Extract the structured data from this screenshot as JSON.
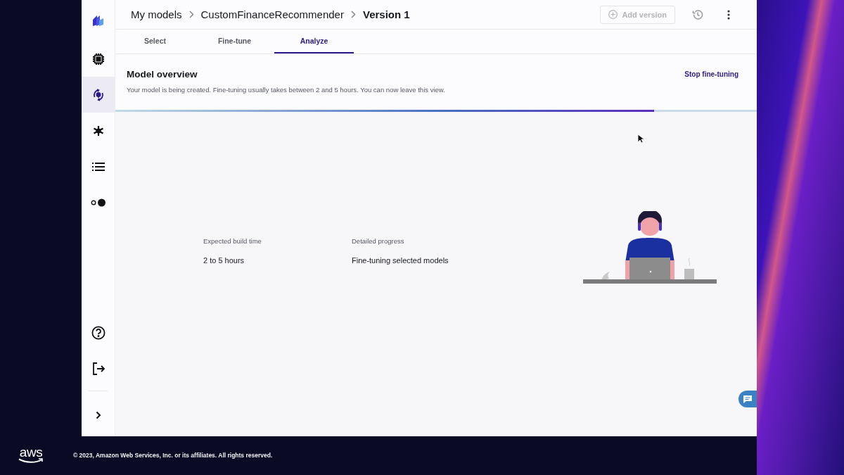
{
  "sidebar": {
    "items": [
      {
        "selected": false
      },
      {
        "selected": true
      },
      {
        "selected": false
      },
      {
        "selected": false
      },
      {
        "selected": false
      }
    ],
    "bottom_items": [
      {
        "selected": false
      },
      {
        "selected": false
      }
    ]
  },
  "breadcrumbs": [
    "My models",
    "CustomFinanceRecommender",
    "Version 1"
  ],
  "header_actions": {
    "add_version": {
      "label": "Add version",
      "disabled": true
    }
  },
  "tabs": [
    {
      "label": "Select",
      "selected": false
    },
    {
      "label": "Fine-tune",
      "selected": false
    },
    {
      "label": "Analyze",
      "selected": true
    }
  ],
  "overview": {
    "title": "Model overview",
    "description": "Your model is being created. Fine-tuning usually takes between 2 and 5 hours. You can now leave this view.",
    "action": "Stop fine-tuning",
    "progress": {
      "level": 0.84
    }
  },
  "details": [
    {
      "label": "Expected build time",
      "value": "2 to 5 hours"
    },
    {
      "label": "Detailed progress",
      "value": "Fine-tuning selected models"
    }
  ],
  "footer": {
    "logo": "aws",
    "copyright": "© 2023, Amazon Web Services, Inc. or its affiliates. All rights reserved."
  }
}
